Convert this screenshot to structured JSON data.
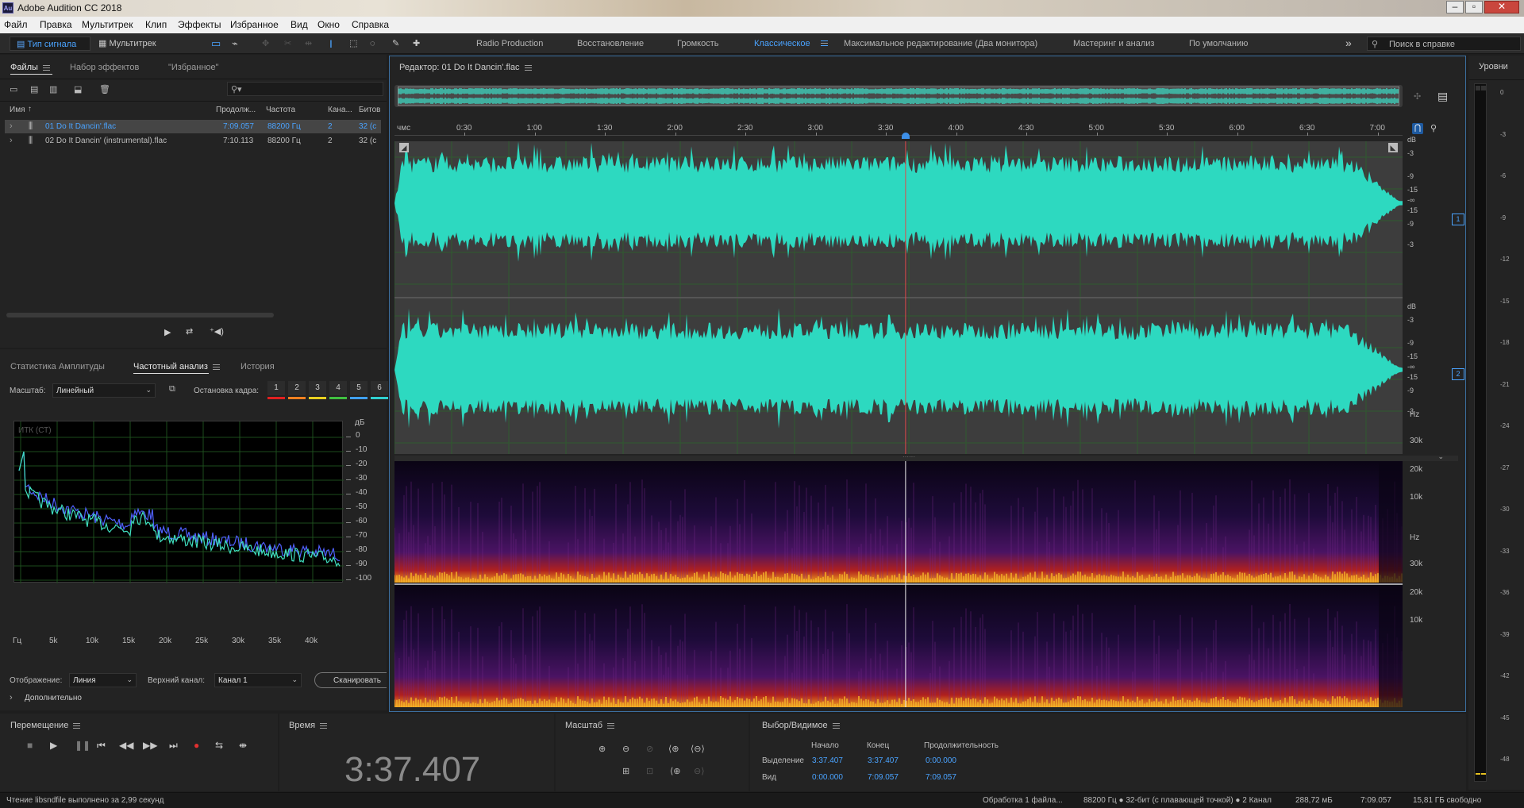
{
  "window": {
    "title": "Adobe Audition CC 2018",
    "app_icon": "Au"
  },
  "menu": [
    "Файл",
    "Правка",
    "Мультитрек",
    "Клип",
    "Эффекты",
    "Избранное",
    "Вид",
    "Окно",
    "Справка"
  ],
  "toolbar": {
    "mode_waveform": "Тип сигнала",
    "mode_multitrack": "Мультитрек",
    "workspaces": [
      "Radio Production",
      "Восстановление",
      "Громкость",
      "Классическое",
      "Максимальное редактирование (Два монитора)",
      "Мастеринг и анализ",
      "По умолчанию"
    ],
    "active_workspace": "Классическое",
    "search_placeholder": "Поиск в справке"
  },
  "files_panel": {
    "tabs": [
      "Файлы",
      "Набор эффектов",
      "\"Избранное\""
    ],
    "columns": [
      "Имя",
      "Продолж...",
      "Частота",
      "Кана...",
      "Битов"
    ],
    "rows": [
      {
        "name": "01 Do It Dancin'.flac",
        "duration": "7:09.057",
        "rate": "88200 Гц",
        "channels": "2",
        "bits": "32 (с",
        "selected": true
      },
      {
        "name": "02 Do It Dancin' (instrumental).flac",
        "duration": "7:10.113",
        "rate": "88200 Гц",
        "channels": "2",
        "bits": "32 (с",
        "selected": false
      }
    ]
  },
  "analysis_panel": {
    "tabs": [
      "Статистика Амплитуды",
      "Частотный анализ",
      "История"
    ],
    "scale_label": "Масштаб:",
    "scale_value": "Линейный",
    "freeze_label": "Остановка кадра:",
    "freeze_buttons": [
      "1",
      "2",
      "3",
      "4",
      "5",
      "6"
    ],
    "freeze_colors": [
      "#e02020",
      "#f08020",
      "#e8d020",
      "#40c040",
      "#40a0f0",
      "#30d0d0"
    ],
    "graph_label": "ИТК (СТ)",
    "db_label": "дБ",
    "db_ticks": [
      "0",
      "-10",
      "-20",
      "-30",
      "-40",
      "-50",
      "-60",
      "-70",
      "-80",
      "-90",
      "-100"
    ],
    "freq_ticks": [
      "Гц",
      "5k",
      "10k",
      "15k",
      "20k",
      "25k",
      "30k",
      "35k",
      "40k"
    ],
    "display_label": "Отображение:",
    "display_value": "Линия",
    "channel_label": "Верхний канал:",
    "channel_value": "Канал 1",
    "scan_button": "Сканировать",
    "advanced": "Дополнительно"
  },
  "editor": {
    "tab_title": "Редактор: 01 Do It Dancin'.flac",
    "ruler_unit": "чмс",
    "ruler_ticks": [
      "0:30",
      "1:00",
      "1:30",
      "2:00",
      "2:30",
      "3:00",
      "3:30",
      "4:00",
      "4:30",
      "5:00",
      "5:30",
      "6:00",
      "6:30",
      "7:00"
    ],
    "db_scale": [
      "dB",
      "-3",
      "-9",
      "-15",
      "-∞",
      "-15",
      "-9",
      "-3"
    ],
    "channel_badges": [
      "1",
      "2"
    ],
    "spectral_labels": [
      "Hz",
      "30k",
      "20k",
      "10k"
    ],
    "playhead_time": "3:37.407",
    "playhead_fraction": 0.507
  },
  "levels": {
    "title": "Уровни",
    "ticks": [
      "0",
      "-3",
      "-6",
      "-9",
      "-12",
      "-15",
      "-18",
      "-21",
      "-24",
      "-27",
      "-30",
      "-33",
      "-36",
      "-39",
      "-42",
      "-45",
      "-48"
    ]
  },
  "transport": {
    "title": "Перемещение",
    "icons": [
      "stop-icon",
      "play-icon",
      "pause-icon",
      "go-to-start-icon",
      "rewind-icon",
      "fast-forward-icon",
      "go-to-end-icon",
      "record-icon",
      "loop-icon",
      "skip-selection-icon"
    ]
  },
  "time_panel": {
    "title": "Время",
    "value": "3:37.407"
  },
  "zoom_panel": {
    "title": "Масштаб"
  },
  "selection_panel": {
    "title": "Выбор/Видимое",
    "headers": [
      "Начало",
      "Конец",
      "Продолжительность"
    ],
    "selection_label": "Выделение",
    "selection": [
      "3:37.407",
      "3:37.407",
      "0:00.000"
    ],
    "view_label": "Вид",
    "view": [
      "0:00.000",
      "7:09.057",
      "7:09.057"
    ]
  },
  "status_bar": {
    "left": "Чтение libsndfile выполнено за 2,99 секунд",
    "processing": "Обработка 1 файла...",
    "format": "88200 Гц ● 32-бит (с плавающей точкой) ● 2 Канал",
    "size": "288,72 мБ",
    "duration": "7:09.057",
    "free": "15,81 ГБ свободно"
  },
  "colors": {
    "waveform": "#2dd9c0",
    "accent": "#4aa3ff",
    "playhead": "#e04848"
  }
}
